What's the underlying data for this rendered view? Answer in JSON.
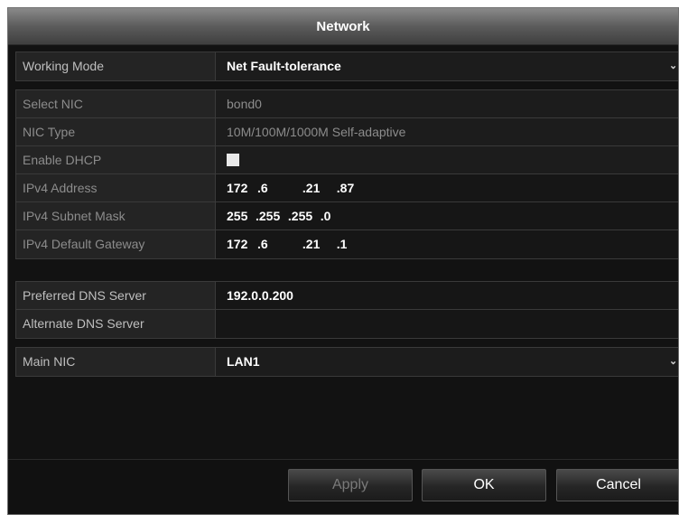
{
  "window": {
    "title": "Network"
  },
  "fields": {
    "working_mode": {
      "label": "Working Mode",
      "value": "Net Fault-tolerance"
    },
    "select_nic": {
      "label": "Select NIC",
      "value": "bond0"
    },
    "nic_type": {
      "label": "NIC Type",
      "value": "10M/100M/1000M Self-adaptive"
    },
    "enable_dhcp": {
      "label": "Enable DHCP",
      "checked": false
    },
    "ipv4_address": {
      "label": "IPv4 Address",
      "octets": [
        "172",
        "6",
        "21",
        "87"
      ]
    },
    "ipv4_subnet_mask": {
      "label": "IPv4 Subnet Mask",
      "octets": [
        "255",
        "255",
        "255",
        "0"
      ]
    },
    "ipv4_default_gateway": {
      "label": "IPv4 Default Gateway",
      "octets": [
        "172",
        "6",
        "21",
        "1"
      ]
    },
    "preferred_dns": {
      "label": "Preferred DNS Server",
      "value": "192.0.0.200"
    },
    "alternate_dns": {
      "label": "Alternate DNS Server",
      "value": ""
    },
    "main_nic": {
      "label": "Main NIC",
      "value": "LAN1"
    }
  },
  "buttons": {
    "apply": "Apply",
    "ok": "OK",
    "cancel": "Cancel"
  },
  "icons": {
    "dropdown_caret": "⌄"
  },
  "colors": {
    "background": "#121212",
    "label_cell": "#242424",
    "border": "#3a3a3a",
    "text": "#ffffff",
    "label_text": "#bfbfbf",
    "disabled_text": "#8c8c8c"
  }
}
